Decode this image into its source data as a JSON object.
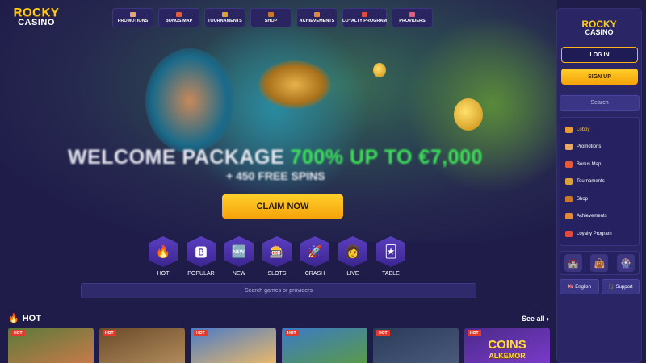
{
  "brand": {
    "line1": "ROCKY",
    "line2": "CASINO"
  },
  "topnav": [
    {
      "label": "PROMOTIONS",
      "icon": "gift-icon",
      "color": "#e8a86a"
    },
    {
      "label": "BONUS MAP",
      "icon": "map-icon",
      "color": "#e65a3a"
    },
    {
      "label": "TOURNAMENTS",
      "icon": "trophy-icon",
      "color": "#d9a23a"
    },
    {
      "label": "SHOP",
      "icon": "chest-icon",
      "color": "#c7782a"
    },
    {
      "label": "ACHIEVEMENTS",
      "icon": "medal-icon",
      "color": "#e08a3a"
    },
    {
      "label": "LOYALTY PROGRAM",
      "icon": "crown-icon",
      "color": "#e24a3a"
    },
    {
      "label": "PROVIDERS",
      "icon": "cards-icon",
      "color": "#e65a7a"
    }
  ],
  "hero": {
    "title_main": "WELCOME PACKAGE ",
    "title_highlight": "700% UP TO €7,000",
    "subtitle": "+ 450 FREE SPINS",
    "cta": "CLAIM NOW"
  },
  "categories": [
    {
      "label": "HOT",
      "icon": "fire-icon",
      "glyph": "🔥"
    },
    {
      "label": "POPULAR",
      "icon": "badge-icon",
      "glyph": "🅱"
    },
    {
      "label": "NEW",
      "icon": "new-icon",
      "glyph": "🆕"
    },
    {
      "label": "SLOTS",
      "icon": "slot-machine-icon",
      "glyph": "🎰"
    },
    {
      "label": "CRASH",
      "icon": "rocket-icon",
      "glyph": "🚀"
    },
    {
      "label": "LIVE",
      "icon": "dealer-icon",
      "glyph": "👩"
    },
    {
      "label": "TABLE",
      "icon": "cards-icon",
      "glyph": "🃏"
    }
  ],
  "main_search": {
    "placeholder": "Search games or providers"
  },
  "hot_section": {
    "title": "HOT",
    "see_all": "See all ›"
  },
  "games": [
    {
      "badge": "HOT",
      "colors": [
        "#5a7a3a",
        "#c77a4a"
      ]
    },
    {
      "badge": "HOT",
      "colors": [
        "#6a4a2a",
        "#b08a5a"
      ]
    },
    {
      "badge": "HOT",
      "colors": [
        "#4a7ac8",
        "#e8b86a"
      ]
    },
    {
      "badge": "HOT",
      "colors": [
        "#3a7ac8",
        "#5a9a4a"
      ]
    },
    {
      "badge": "HOT",
      "colors": [
        "#2a3a5a",
        "#4a5a7a"
      ]
    },
    {
      "badge": "HOT",
      "colors": [
        "#4a2a8a",
        "#7a3ac8"
      ],
      "title": "COINS",
      "title2": "ALKEMOR"
    }
  ],
  "sidebar": {
    "login": "LOG IN",
    "signup": "SIGN UP",
    "search_placeholder": "Search",
    "menu": [
      {
        "label": "Lobby",
        "icon": "lobby-icon",
        "color": "#e89a3a",
        "active": true
      },
      {
        "label": "Promotions",
        "icon": "gift-icon",
        "color": "#e8a86a",
        "active": false
      },
      {
        "label": "Bonus Map",
        "icon": "map-icon",
        "color": "#e65a3a",
        "active": false
      },
      {
        "label": "Tournaments",
        "icon": "trophy-icon",
        "color": "#d9a23a",
        "active": false
      },
      {
        "label": "Shop",
        "icon": "chest-icon",
        "color": "#c7782a",
        "active": false
      },
      {
        "label": "Achievements",
        "icon": "medal-icon",
        "color": "#e08a3a",
        "active": false
      },
      {
        "label": "Loyalty Program",
        "icon": "crown-icon",
        "color": "#e24a3a",
        "active": false
      }
    ],
    "quick_icons": [
      "castle-icon",
      "bag-icon",
      "wheel-icon"
    ],
    "language": "English",
    "support": "Support"
  },
  "colors": {
    "accent": "#ffb21a",
    "highlight": "#3ee65a",
    "background": "#1f1c4a"
  }
}
